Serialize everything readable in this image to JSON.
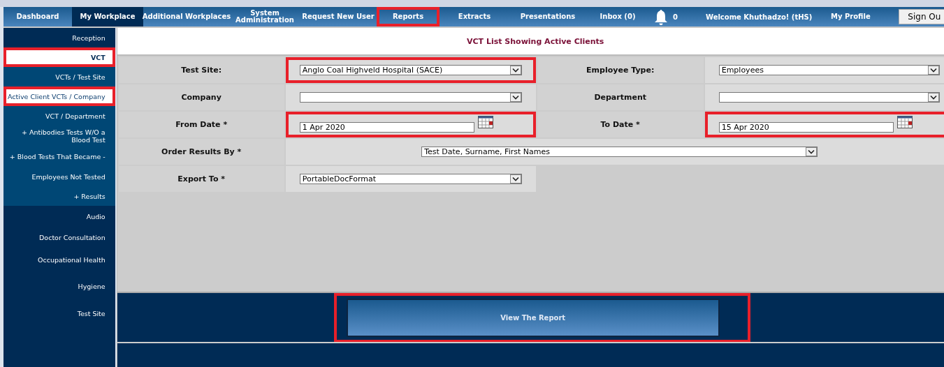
{
  "nav": [
    {
      "label": "Dashboard",
      "selected": false,
      "highlighted": false
    },
    {
      "label": "My Workplace",
      "selected": true,
      "highlighted": false
    },
    {
      "label": "Additional Workplaces",
      "selected": false,
      "highlighted": false
    },
    {
      "label": "System Administration",
      "selected": false,
      "highlighted": false
    },
    {
      "label": "Request New User",
      "selected": false,
      "highlighted": false
    },
    {
      "label": "Reports",
      "selected": false,
      "highlighted": true
    },
    {
      "label": "Extracts",
      "selected": false,
      "highlighted": false
    },
    {
      "label": "Presentations",
      "selected": false,
      "highlighted": false
    },
    {
      "label": "Inbox (0)",
      "selected": false,
      "highlighted": false
    }
  ],
  "notifications": "0",
  "welcome": "Welcome Khuthadzo! (tHS)",
  "profile": "My Profile",
  "sign_out": "Sign Ou",
  "sidebar": [
    {
      "label": "Reception",
      "kind": "main",
      "selected": false,
      "highlighted": false
    },
    {
      "label": "VCT",
      "kind": "main",
      "selected": true,
      "highlighted": true
    },
    {
      "label": "VCTs / Test Site",
      "kind": "sub",
      "selected": false,
      "highlighted": false
    },
    {
      "label": "Active Client VCTs / Company",
      "kind": "sub",
      "selected": true,
      "highlighted": true
    },
    {
      "label": "VCT / Department",
      "kind": "sub",
      "selected": false,
      "highlighted": false
    },
    {
      "label": "+ Antibodies Tests W/O a Blood Test",
      "kind": "sub",
      "selected": false,
      "highlighted": false
    },
    {
      "label": "+ Blood Tests That Became -",
      "kind": "sub",
      "selected": false,
      "highlighted": false
    },
    {
      "label": "Employees Not Tested",
      "kind": "sub",
      "selected": false,
      "highlighted": false
    },
    {
      "label": "+ Results",
      "kind": "sub",
      "selected": false,
      "highlighted": false
    },
    {
      "label": "Audio",
      "kind": "main",
      "selected": false,
      "highlighted": false
    },
    {
      "label": "Doctor Consultation",
      "kind": "main",
      "selected": false,
      "highlighted": false
    },
    {
      "label": "Occupational Health",
      "kind": "main",
      "selected": false,
      "highlighted": false
    },
    {
      "label": "Hygiene",
      "kind": "main",
      "selected": false,
      "highlighted": false
    },
    {
      "label": "Test Site",
      "kind": "main",
      "selected": false,
      "highlighted": false
    }
  ],
  "form_title": "VCT List Showing Active Clients",
  "rows": [
    [
      {
        "label": "Test Site:",
        "kind": "select",
        "value": "Anglo Coal Highveld Hospital (SACE)",
        "highlighted": true
      },
      {
        "label": "Employee Type:",
        "kind": "select",
        "value": "Employees",
        "highlighted": false
      }
    ],
    [
      {
        "label": "Company",
        "kind": "select",
        "highlighted": false
      },
      {
        "label": "Department",
        "kind": "select",
        "highlighted": false
      }
    ],
    [
      {
        "label": "From Date *",
        "kind": "date",
        "value": "1 Apr 2020",
        "highlighted": true
      },
      {
        "label": "To Date *",
        "kind": "date",
        "value": "15 Apr 2020",
        "highlighted": true
      }
    ],
    [
      {
        "label": "Order Results By *",
        "kind": "wide-select",
        "value": "Test Date, Surname, First Names",
        "highlighted": false
      }
    ],
    [
      {
        "label": "Export To *",
        "kind": "select",
        "value": "PortableDocFormat",
        "highlighted": false
      }
    ]
  ],
  "submit": {
    "label": "View The Report",
    "highlighted": true
  }
}
